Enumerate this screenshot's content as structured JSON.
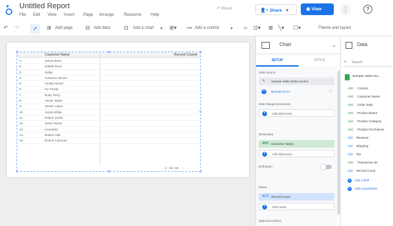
{
  "app": {
    "title": "Untitled Report",
    "menu": [
      "File",
      "Edit",
      "View",
      "Insert",
      "Page",
      "Arrange",
      "Resource",
      "Help"
    ],
    "reset_label": "Reset",
    "share_label": "Share",
    "view_label": "View"
  },
  "toolbar": {
    "add_page": "Add page",
    "add_data": "Add data",
    "add_chart": "Add a chart",
    "add_control": "Add a control",
    "theme": "Theme and layout"
  },
  "table": {
    "col_name": "Customer Name",
    "col_count": "Record Count",
    "rows": [
      {
        "num": "1.",
        "name": "James Bore"
      },
      {
        "num": "2.",
        "name": "Isabelt Doon"
      },
      {
        "num": "3.",
        "name": "Sofan"
      },
      {
        "num": "4.",
        "name": "Cameron Moore"
      },
      {
        "num": "5.",
        "name": "Amelia Wood"
      },
      {
        "num": "6.",
        "name": "Ivy Young"
      },
      {
        "num": "7.",
        "name": "Ruby Perry"
      },
      {
        "num": "8.",
        "name": "Xavier Taylor"
      },
      {
        "num": "9.",
        "name": "Xavier Lopez"
      },
      {
        "num": "10.",
        "name": "Jacob White"
      },
      {
        "num": "11.",
        "name": "Robert Smith"
      },
      {
        "num": "12.",
        "name": "Jason Wood"
      },
      {
        "num": "13.",
        "name": "Leonardo"
      },
      {
        "num": "14.",
        "name": "Robert Hall"
      },
      {
        "num": "15.",
        "name": "Rohan Coleman"
      }
    ],
    "pager": "1 - 15 / 16"
  },
  "chart_panel": {
    "title": "Chart",
    "tab_setup": "SETUP",
    "tab_style": "STYLE",
    "data_source_label": "Data source",
    "data_source": "Sample Sales Data Source",
    "blend_data": "BLEND DATA",
    "date_range_label": "Date Range Dimension",
    "add_dimension": "Add dimension",
    "dimension_label": "Dimension",
    "dimension": "Customer Name",
    "drill_down": "Drill down",
    "metric_label": "Metric",
    "metric": "Record Count",
    "add_metric": "Add metric",
    "optional_metrics": "Optional metrics"
  },
  "data_panel": {
    "title": "Data",
    "search_placeholder": "Search",
    "source": "Sample Sales Da...",
    "fields": [
      {
        "name": "Country",
        "kind": "dimension"
      },
      {
        "name": "Customer Name",
        "kind": "dimension"
      },
      {
        "name": "Order Date",
        "kind": "dimension"
      },
      {
        "name": "Product Brand",
        "kind": "dimension"
      },
      {
        "name": "Product Category",
        "kind": "dimension"
      },
      {
        "name": "Product Purchased",
        "kind": "dimension"
      },
      {
        "name": "Revenue",
        "kind": "metric"
      },
      {
        "name": "Shipping",
        "kind": "metric"
      },
      {
        "name": "Tax",
        "kind": "metric"
      },
      {
        "name": "Transaction ID",
        "kind": "dimension"
      },
      {
        "name": "Record Count",
        "kind": "metric"
      }
    ],
    "add_field": "Add a field",
    "add_parameter": "Add a parameter"
  }
}
